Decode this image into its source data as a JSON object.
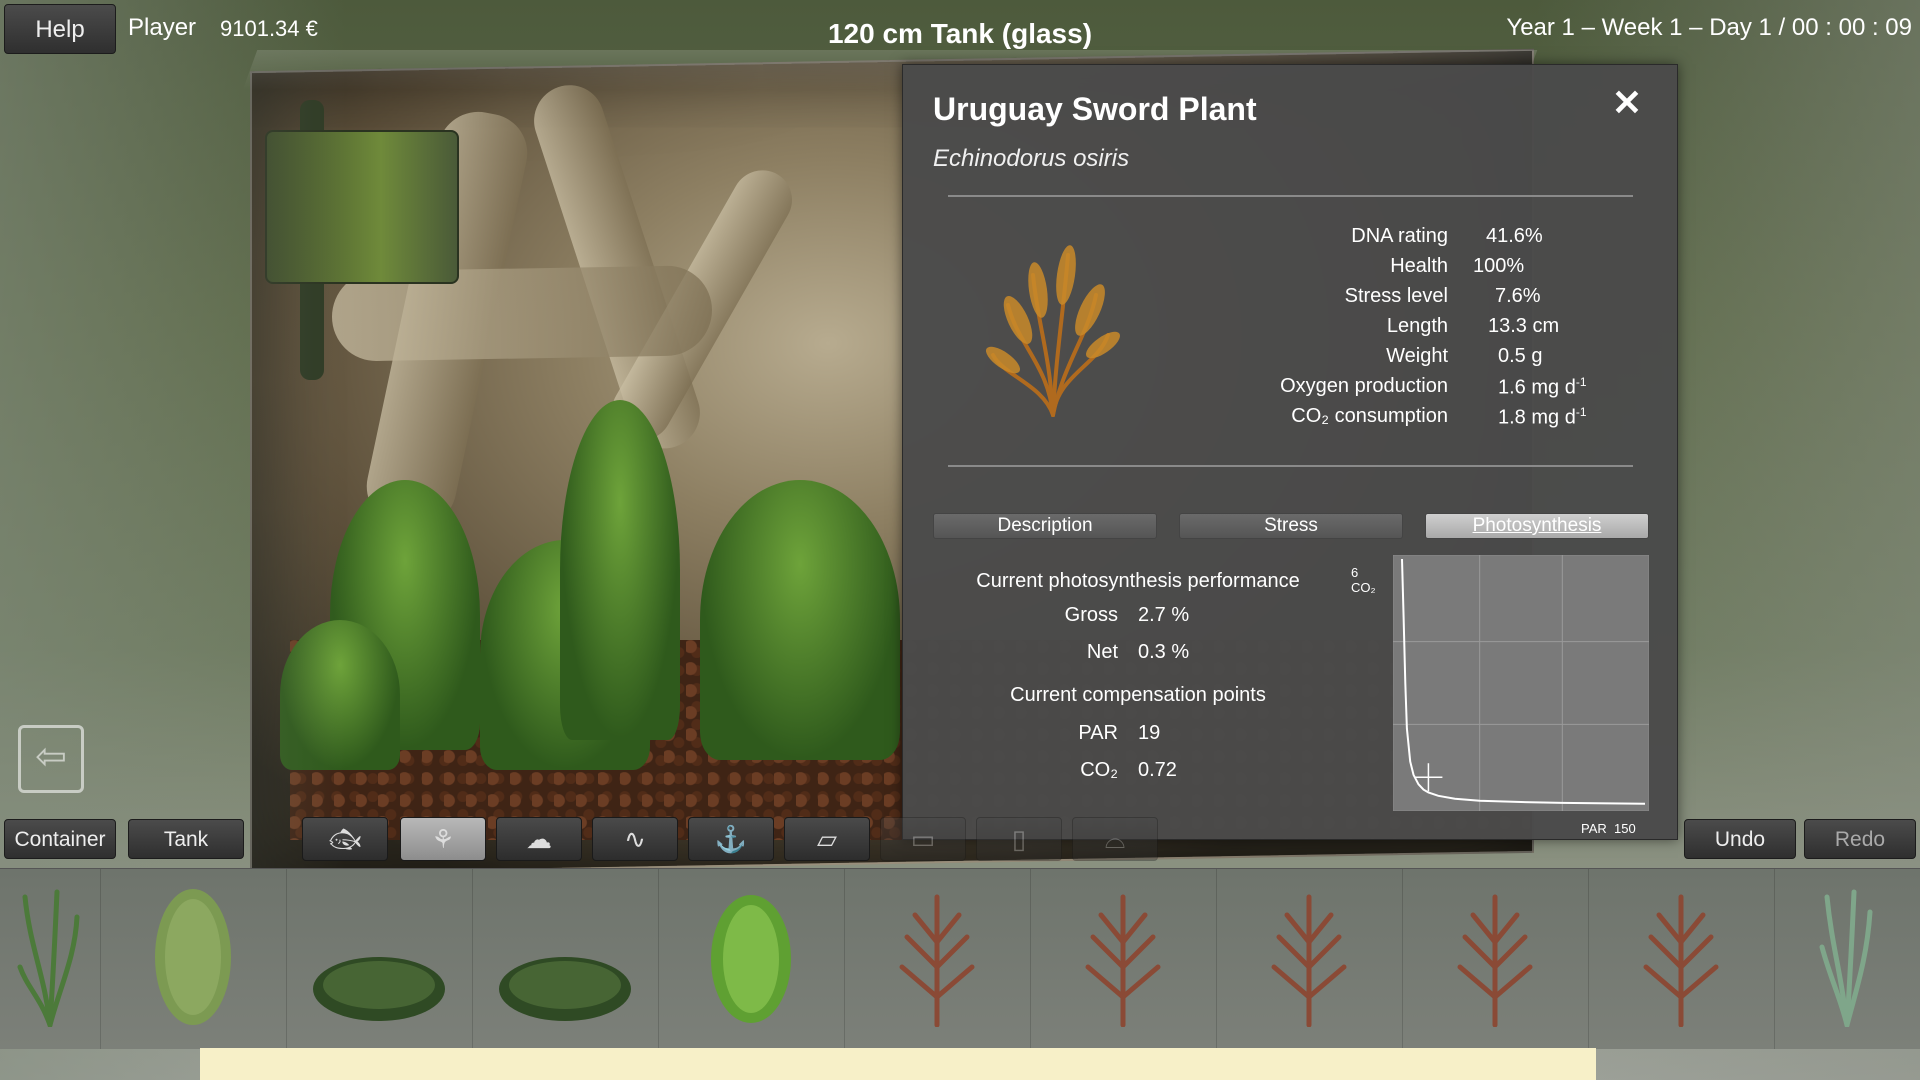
{
  "topbar": {
    "help": "Help",
    "player_label": "Player",
    "player_money": "9101.34 €",
    "tank_title": "120 cm Tank (glass)",
    "game_time": "Year 1 – Week 1 – Day 1  /  00 : 00 : 09"
  },
  "panel": {
    "title": "Uruguay Sword Plant",
    "scientific_name": "Echinodorus osiris",
    "stats": [
      {
        "label": "DNA rating",
        "value": "41.6%"
      },
      {
        "label": "Health",
        "value": "100%"
      },
      {
        "label": "Stress level",
        "value": "7.6%"
      },
      {
        "label": "Length",
        "value": "13.3 cm"
      },
      {
        "label": "Weight",
        "value": "0.5 g"
      },
      {
        "label": "Oxygen production",
        "value": "1.6 mg d",
        "value_sup": "-1"
      },
      {
        "label": "CO₂ consumption",
        "value": "1.8 mg d",
        "value_sup": "-1"
      }
    ],
    "tabs": [
      "Description",
      "Stress",
      "Photosynthesis"
    ],
    "active_tab": "Photosynthesis",
    "photosynthesis": {
      "performance_heading": "Current photosynthesis performance",
      "gross_label": "Gross",
      "gross_value": "2.7 %",
      "net_label": "Net",
      "net_value": "0.3 %",
      "compensation_heading": "Current compensation points",
      "par_label": "PAR",
      "par_value": "19",
      "co2_label": "CO₂",
      "co2_value": "0.72"
    },
    "graph": {
      "y_max_label": "6",
      "y_label": "CO₂",
      "x_label": "PAR",
      "x_max_label": "150"
    }
  },
  "chart_data": {
    "type": "line",
    "xlabel": "PAR",
    "ylabel": "CO₂",
    "xlim": [
      0,
      150
    ],
    "ylim": [
      0,
      6
    ],
    "grid": true,
    "series": [
      {
        "x": [
          3,
          4,
          5,
          6,
          8,
          10,
          13,
          16,
          19,
          25,
          35,
          50,
          75,
          100,
          150
        ],
        "values": [
          6.0,
          4.6,
          3.0,
          1.9,
          1.1,
          0.78,
          0.55,
          0.42,
          0.35,
          0.27,
          0.2,
          0.15,
          0.12,
          0.1,
          0.08
        ]
      }
    ],
    "marker": {
      "x": 19,
      "y": 0.72
    }
  },
  "toolbar": {
    "container": "Container",
    "tank": "Tank",
    "undo": "Undo",
    "redo": "Redo",
    "tools": [
      "fish-icon",
      "plant-icon",
      "rock-icon",
      "driftwood-icon",
      "anchor-icon",
      "substrate-icon",
      "background-icon",
      "equipment-icon",
      "lighting-icon"
    ],
    "active_tool": "plant-icon"
  },
  "shelf": {
    "items": [
      "grass-plant",
      "bushy-green-plant",
      "carpet-plant",
      "carpet-plant",
      "light-green-fern",
      "red-sword-plant",
      "red-sword-plant",
      "red-sword-plant",
      "red-sword-plant",
      "red-sword-plant",
      "tall-grass-plant"
    ]
  },
  "colors": {
    "panel_bg": "#4a4a4a",
    "active_tab": "#bdbdbd",
    "graph_bg": "#7a7a7a",
    "curve": "#ffffff",
    "footer_bar": "#f7f0c8"
  }
}
